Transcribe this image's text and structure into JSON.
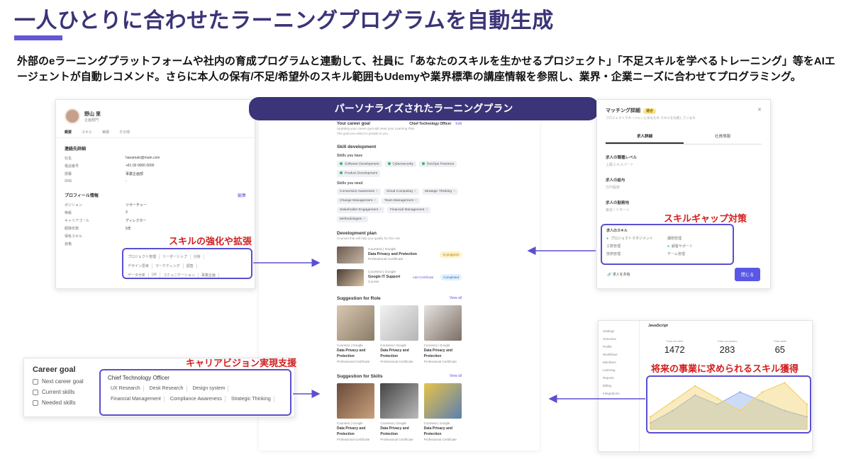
{
  "page": {
    "title": "一人ひとりに合わせたラーニングプログラムを自動生成",
    "lead": "外部のeラーニングプラットフォームや社内の育成プログラムと連動して、社員に「あなたのスキルを生かせるプロジェクト」「不足スキルを学べるトレーニング」等をAIエージェントが自動レコメンド。さらに本人の保有/不足/希望外のスキル範囲もUdemyや業界標準の講座情報を参照し、業界・企業ニーズに合わせてプログラミング。",
    "center_banner": "パーソナライズされたラーニングプラン"
  },
  "callouts": {
    "skills": "スキルの強化や拡張",
    "gap": "スキルギャップ対策",
    "career": "キャリアビジョン実現支援",
    "future": "将来の事業に求められるスキル獲得"
  },
  "profile": {
    "name": "野山 里",
    "sub": "企画部門",
    "tabs": [
      "概要",
      "スキル",
      "実績",
      "その他"
    ],
    "contact_title": "連絡先詳細",
    "contact_rows": [
      {
        "k": "社名",
        "v": "hanamaki@main.com"
      },
      {
        "k": "電話番号",
        "v": "+81 00 0000 0000"
      },
      {
        "k": "部署",
        "v": "事業企画部"
      },
      {
        "k": "SNS",
        "v": "-"
      }
    ],
    "profile_title": "プロフィール情報",
    "profile_link": "編集",
    "profile_rows": [
      {
        "k": "ポジション",
        "v": "リサーチャー"
      },
      {
        "k": "等級",
        "v": "3"
      },
      {
        "k": "キャリアゴール",
        "v": "ディレクター"
      },
      {
        "k": "経験年数",
        "v": "5年"
      },
      {
        "k": "保有スキル",
        "v": ""
      },
      {
        "k": "資格",
        "v": ""
      }
    ],
    "skill_chips": [
      [
        "プロジェクト管理",
        "リーダーシップ",
        "分析"
      ],
      [
        "デザイン思考",
        "マーケティング",
        "調査"
      ],
      [
        "データ分析",
        "UX",
        "コミュニケーション",
        "事業企画"
      ]
    ]
  },
  "plan": {
    "goal_heading": "Your career goal",
    "goal_hint_1": "Updating your career goal will reset your Learning Plan",
    "goal_hint_2": "The goal you select is private to you.",
    "goal_value": "Chief Technology Officer",
    "edit": "Edit",
    "skill_dev": "Skill development",
    "skills_have_label": "Skills you have",
    "skills_have": [
      "Software Development",
      "Cybersecurity",
      "DevOps Practices",
      "Product Development"
    ],
    "skills_need_label": "Skills you need",
    "skills_need": [
      "Conversion Awareness",
      "Cloud Computing",
      "Strategic Thinking",
      "Change Management",
      "Team Management",
      "Stakeholder Engagement",
      "Financial Management",
      "Methodologies"
    ],
    "dev_plan": "Development plan",
    "dev_hint": "Courses that will help you qualify for this role.",
    "items": [
      {
        "provider": "Coursera | Google",
        "title": "Data Privacy and Protection",
        "type": "Professional Certificate",
        "status": "In progress",
        "tone": "yellow"
      },
      {
        "provider": "Coursera | Google",
        "title": "Google IT Support",
        "type": "Course",
        "status": "Completed",
        "tone": "blue",
        "extra": "Add Certificate"
      }
    ],
    "role_head": "Suggestion for Role",
    "skills_head": "Suggestion for Skills",
    "view_all": "View all",
    "card_provider": "Coursera | Google",
    "card_title": "Data Privacy and Protection",
    "card_type": "Professional Certificate"
  },
  "matching": {
    "title": "マッチング詳細",
    "badge": "適合",
    "desc": "プロジェクトマネージャーとあなたの スキルを比較しています",
    "tabs": [
      "求人詳細",
      "社員情報"
    ],
    "fields": [
      {
        "label": "求人の職種レベル",
        "value": "上級エキスパート"
      },
      {
        "label": "求人の給与",
        "value": "万円程度"
      },
      {
        "label": "求人の勤務地",
        "value": "東京 / リモート"
      }
    ],
    "gap_label": "求人のスキル",
    "gap_items": [
      "プロジェクトマネジメント",
      "課題管理",
      "工数管理",
      "顧客サポート",
      "技術管理",
      "チーム管理"
    ],
    "footer": "求人を共有",
    "button": "閉じる"
  },
  "career": {
    "title": "Career goal",
    "rows": [
      "Next career goal",
      "Current skills",
      "Needed skills"
    ],
    "goal": "Chief Technology Officer",
    "chips": [
      "UX Research",
      "Desk Research",
      "Design system",
      "Financial Management",
      "Compliance Awareness",
      "Strategic Thinking"
    ]
  },
  "analytics": {
    "title": "JavaScript",
    "side": [
      "Settings",
      "Overview",
      "Profile",
      "Workflows",
      "Members",
      "Learning",
      "Reports",
      "Billing",
      "Integrations"
    ],
    "stats": [
      {
        "label": "Total enrolled",
        "value": "1472"
      },
      {
        "label": "Total completed",
        "value": "283"
      },
      {
        "label": "Total skills",
        "value": "65"
      }
    ]
  },
  "chart_data": {
    "type": "area",
    "series": [
      {
        "name": "",
        "color": "#8fb0ef",
        "values": [
          10,
          30,
          55,
          40,
          60,
          45,
          30,
          20
        ]
      },
      {
        "name": "",
        "color": "#f1d26e",
        "values": [
          20,
          45,
          70,
          50,
          30,
          60,
          75,
          40
        ]
      }
    ]
  }
}
